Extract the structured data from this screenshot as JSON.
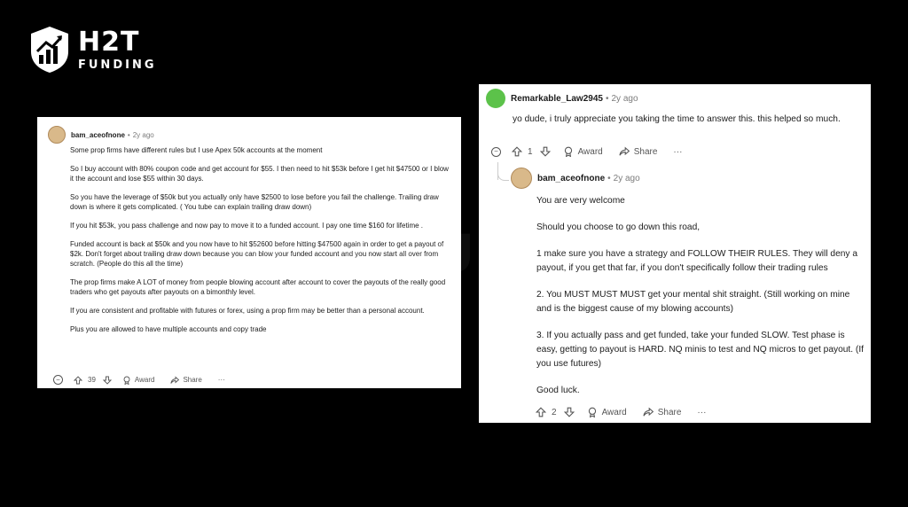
{
  "logo": {
    "h2t": "H2T",
    "funding": "FUNDING"
  },
  "watermark": "H2T FUNDING",
  "card1": {
    "username": "bam_aceofnone",
    "time": "2y ago",
    "paragraphs": [
      "Some prop firms have different rules but I use Apex 50k accounts at the moment",
      "So I buy account with 80% coupon code and get account for $55. I then need to hit $53k before I get hit $47500 or I blow it the account and lose $55 within 30 days.",
      "So you have the leverage of $50k but you actually only have $2500 to lose before you fail the challenge. Trailing draw down is where it gets complicated. ( You tube can explain trailing draw down)",
      "If you hit $53k, you pass challenge and now pay to move it to a funded account. I pay one time $160 for lifetime .",
      "Funded account is back at $50k and you now have to hit $52600 before hitting $47500 again in order to get a payout of $2k. Don't forget about trailing draw down because you can blow your funded account and you now start all over from scratch. (People do this all the time)",
      "The prop firms make A LOT of money from people blowing account after account to cover the payouts of the really good traders who get payouts after payouts on a bimonthly level.",
      "If you are consistent and profitable with futures or forex, using a prop firm may be better than a personal account.",
      "Plus you are allowed to have multiple accounts and copy trade"
    ],
    "votes": "39",
    "award": "Award",
    "share": "Share",
    "more": "···"
  },
  "card2": {
    "reply_user": "Remarkable_Law2945",
    "reply_time": "2y ago",
    "reply_text": "yo dude, i truly appreciate you taking the time to answer this. this helped so much.",
    "reply_votes": "1",
    "award": "Award",
    "share": "Share",
    "more": "···",
    "user2": "bam_aceofnone",
    "time2": "2y ago",
    "paragraphs": [
      "You are very welcome",
      "Should you choose to go down this road,",
      "1 make sure you have a strategy and FOLLOW THEIR RULES. They will deny a payout, if you get that far, if you don't specifically follow their trading rules",
      "2. You MUST MUST MUST get your mental shit straight. (Still working on mine and is the biggest cause of my blowing accounts)",
      "3. If you actually pass and get funded, take your funded SLOW. Test phase is easy, getting to payout is HARD. NQ minis to test and NQ micros to get payout. (If you use futures)",
      "Good luck."
    ],
    "votes2": "2"
  },
  "icons": [
    "shield-chart-logo-icon",
    "upvote-icon",
    "downvote-icon",
    "award-icon",
    "share-icon",
    "collapse-icon",
    "more-icon",
    "avatar-icon"
  ]
}
